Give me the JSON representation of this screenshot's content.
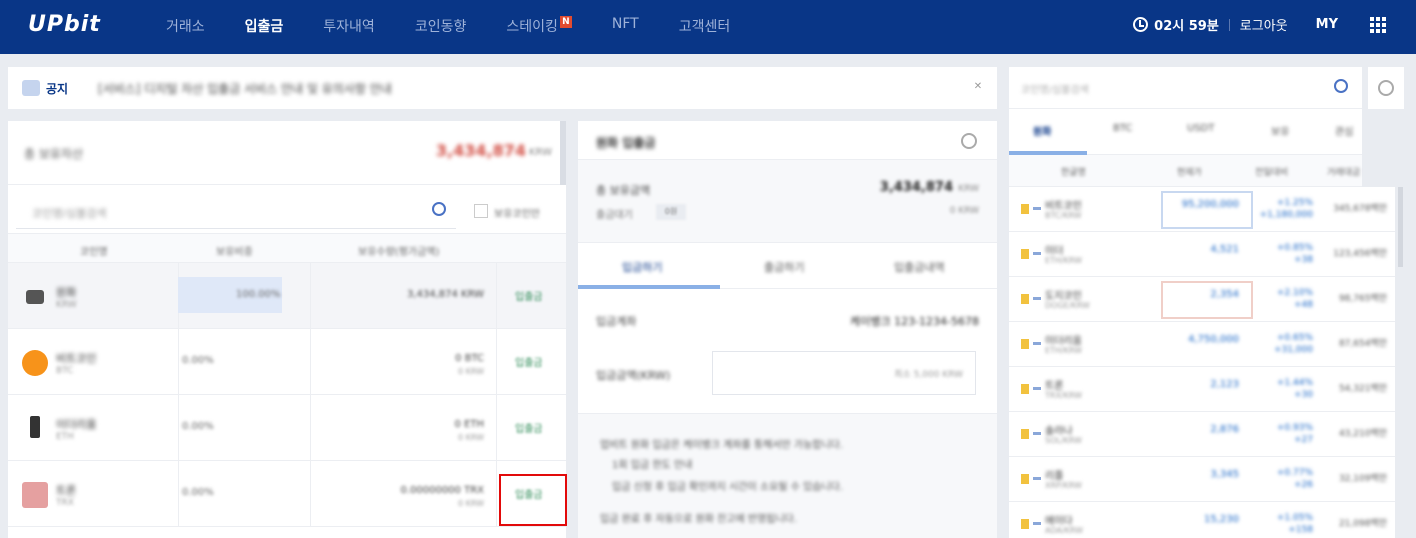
{
  "header": {
    "logo": "UPbit",
    "nav": [
      {
        "label": "거래소",
        "active": false
      },
      {
        "label": "입출금",
        "active": true
      },
      {
        "label": "투자내역",
        "active": false
      },
      {
        "label": "코인동향",
        "active": false
      },
      {
        "label": "스테이킹",
        "active": false,
        "badge": "N"
      },
      {
        "label": "NFT",
        "active": false
      },
      {
        "label": "고객센터",
        "active": false
      }
    ],
    "time": "02시 59분",
    "logout": "로그아웃",
    "my": "MY"
  },
  "notice": {
    "tag": "공지",
    "text": "[서비스] 디지털 자산 입출금 서비스 안내 및 유의사항 안내"
  },
  "assets": {
    "label": "총 보유자산",
    "value": "3,434,874",
    "unit": "KRW",
    "search_placeholder": "코인명/심볼검색",
    "hold_only_label": "보유코인만",
    "columns": [
      "코인명",
      "보유비중",
      "보유수량(평가금액)",
      ""
    ]
  },
  "coins": [
    {
      "name": "원화",
      "sym": "KRW",
      "ratio": "100.00%",
      "amount": "3,434,874 KRW",
      "amount_sub": "",
      "action": "입출금",
      "color": "#555555"
    },
    {
      "name": "비트코인",
      "sym": "BTC",
      "ratio": "0.00%",
      "amount": "0 BTC",
      "amount_sub": "0 KRW",
      "action": "입출금",
      "color": "#f7931a"
    },
    {
      "name": "이더리움",
      "sym": "ETH",
      "ratio": "0.00%",
      "amount": "0 ETH",
      "amount_sub": "0 KRW",
      "action": "입출금",
      "color": "#333333"
    },
    {
      "name": "트론",
      "sym": "TRX",
      "ratio": "0.00%",
      "amount": "0.00000000 TRX",
      "amount_sub": "0 KRW",
      "action": "입출금",
      "color": "#e5a0a0"
    }
  ],
  "withdraw": {
    "title": "원화 입출금",
    "balance_label": "총 보유금액",
    "balance_value": "3,434,874",
    "balance_unit": "KRW",
    "pending_label": "출금대기",
    "pending_tag": "0원",
    "pending_value": "0 KRW",
    "tabs": [
      "입금하기",
      "출금하기",
      "입출금내역"
    ],
    "bank_label": "입금계좌",
    "bank_value": "케이뱅크 123-1234-5678",
    "amount_label": "입금금액(KRW)",
    "amount_placeholder": "최소 5,000 KRW",
    "info_lines": [
      "업비트 원화 입금은 케이뱅크 계좌를 통해서만 가능합니다.",
      "1회 입금 한도 안내",
      "입금 신청 후 입금 확인까지 시간이 소요될 수 있습니다.",
      "입금 완료 후 자동으로 원화 잔고에 반영됩니다."
    ]
  },
  "market": {
    "search_placeholder": "코인명/심볼검색",
    "tabs": [
      "원화",
      "BTC",
      "USDT",
      "보유",
      "관심"
    ],
    "columns": [
      "한글명",
      "현재가",
      "전일대비",
      "거래대금"
    ],
    "rows": [
      {
        "name": "비트코인",
        "sym": "BTC/KRW",
        "price": "95,200,000",
        "change": "+1.25%",
        "change_sub": "+1,180,000",
        "vol": "345,678백만",
        "box": "blue"
      },
      {
        "name": "이더",
        "sym": "ETH/KRW",
        "price": "4,521",
        "change": "+0.85%",
        "change_sub": "+38",
        "vol": "123,456백만",
        "box": ""
      },
      {
        "name": "도지코인",
        "sym": "DOGE/KRW",
        "price": "2,354",
        "change": "+2.10%",
        "change_sub": "+48",
        "vol": "98,765백만",
        "box": "red"
      },
      {
        "name": "이더리움",
        "sym": "ETH/KRW",
        "price": "4,750,000",
        "change": "+0.65%",
        "change_sub": "+31,000",
        "vol": "87,654백만",
        "box": ""
      },
      {
        "name": "트론",
        "sym": "TRX/KRW",
        "price": "2,123",
        "change": "+1.44%",
        "change_sub": "+30",
        "vol": "54,321백만",
        "box": ""
      },
      {
        "name": "솔라나",
        "sym": "SOL/KRW",
        "price": "2,876",
        "change": "+0.93%",
        "change_sub": "+27",
        "vol": "43,210백만",
        "box": ""
      },
      {
        "name": "리플",
        "sym": "XRP/KRW",
        "price": "3,345",
        "change": "+0.77%",
        "change_sub": "+26",
        "vol": "32,109백만",
        "box": ""
      },
      {
        "name": "에이다",
        "sym": "ADA/KRW",
        "price": "15,230",
        "change": "+1.05%",
        "change_sub": "+158",
        "vol": "21,098백만",
        "box": ""
      }
    ]
  },
  "colors": {
    "header_bg": "#093687",
    "accent_red": "#d24f45",
    "accent_blue": "#1261c4",
    "highlight_box": "#e20a0a"
  }
}
